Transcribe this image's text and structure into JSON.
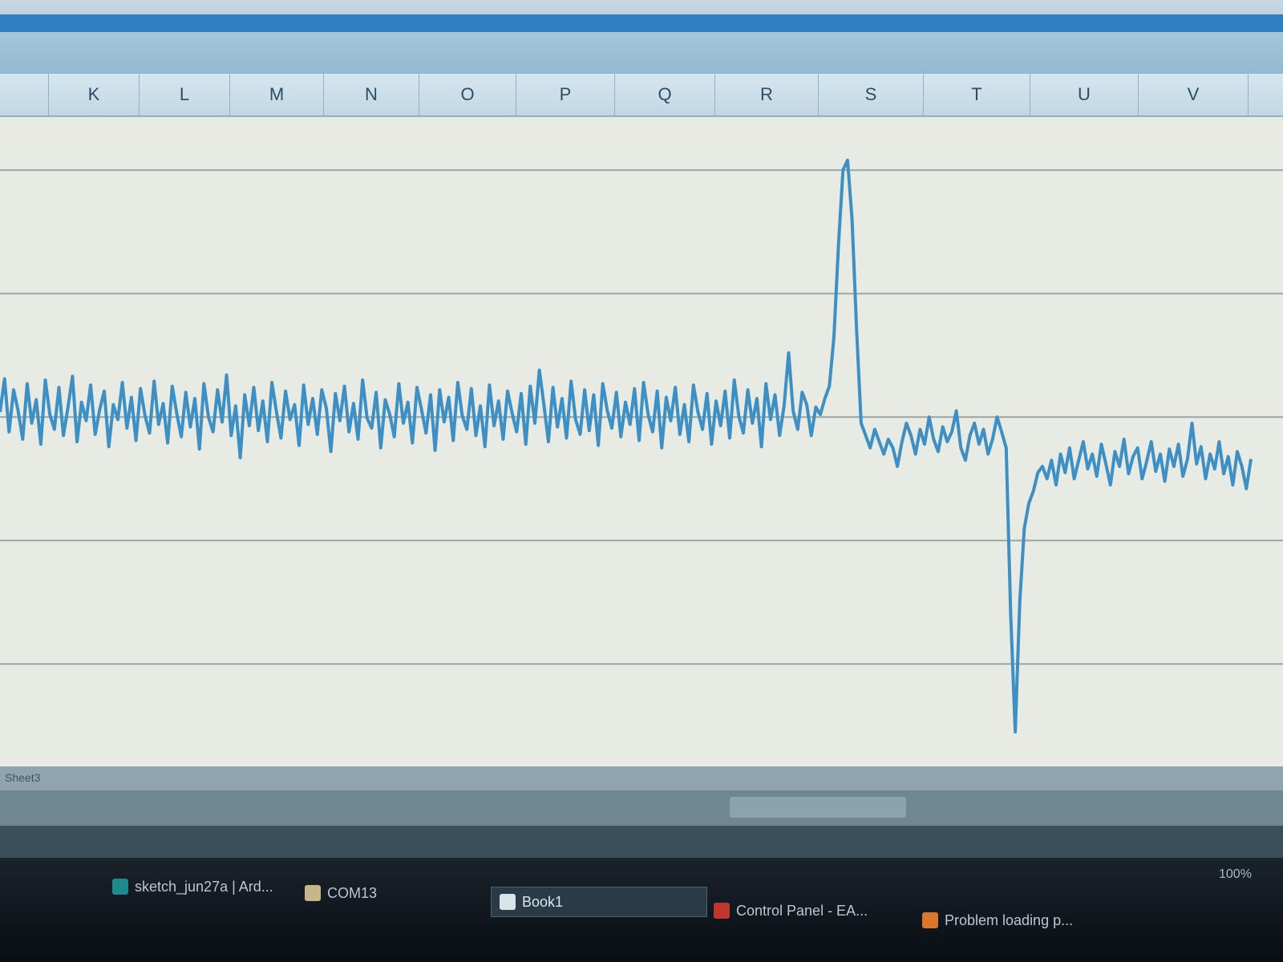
{
  "app": {
    "window": "Book1"
  },
  "column_headers": [
    "K",
    "L",
    "M",
    "N",
    "O",
    "P",
    "Q",
    "R",
    "S",
    "T",
    "U",
    "V"
  ],
  "sheet_tab": "Sheet3",
  "taskbar": {
    "items": [
      {
        "label": "sketch_jun27a | Ard...",
        "icon": "arduino-icon",
        "active": false
      },
      {
        "label": "COM13",
        "icon": "window-icon",
        "active": false
      },
      {
        "label": "Book1",
        "icon": "excel-icon",
        "active": true
      },
      {
        "label": "Control Panel - EA...",
        "icon": "control-panel-icon",
        "active": false
      },
      {
        "label": "Problem loading p...",
        "icon": "firefox-icon",
        "active": false
      }
    ]
  },
  "status": {
    "zoom": "100%"
  },
  "colors": {
    "series": "#3d8fc4",
    "plot_bg": "#e7ebe3",
    "gridline": "#9aa6a6"
  },
  "chart_data": {
    "type": "line",
    "series": [
      {
        "values": [
          0.04,
          0.31,
          -0.12,
          0.22,
          0.05,
          -0.18,
          0.27,
          -0.05,
          0.14,
          -0.22,
          0.3,
          0.02,
          -0.1,
          0.24,
          -0.15,
          0.08,
          0.33,
          -0.2,
          0.12,
          -0.03,
          0.26,
          -0.14,
          0.06,
          0.21,
          -0.24,
          0.1,
          -0.02,
          0.28,
          -0.09,
          0.16,
          -0.19,
          0.23,
          0.01,
          -0.13,
          0.29,
          -0.06,
          0.11,
          -0.21,
          0.25,
          0.03,
          -0.16,
          0.2,
          -0.08,
          0.15,
          -0.26,
          0.27,
          0.0,
          -0.12,
          0.22,
          -0.04,
          0.34,
          -0.15,
          0.09,
          -0.33,
          0.18,
          -0.07,
          0.24,
          -0.11,
          0.13,
          -0.2,
          0.28,
          0.04,
          -0.17,
          0.21,
          -0.02,
          0.1,
          -0.23,
          0.26,
          -0.06,
          0.15,
          -0.14,
          0.22,
          0.07,
          -0.28,
          0.19,
          -0.03,
          0.25,
          -0.12,
          0.11,
          -0.18,
          0.3,
          -0.01,
          -0.09,
          0.2,
          -0.25,
          0.14,
          0.02,
          -0.16,
          0.27,
          -0.05,
          0.12,
          -0.21,
          0.24,
          0.06,
          -0.13,
          0.18,
          -0.27,
          0.22,
          -0.04,
          0.16,
          -0.19,
          0.28,
          0.01,
          -0.1,
          0.23,
          -0.15,
          0.09,
          -0.24,
          0.26,
          -0.07,
          0.13,
          -0.18,
          0.21,
          0.03,
          -0.12,
          0.19,
          -0.22,
          0.25,
          -0.05,
          0.38,
          0.1,
          -0.2,
          0.24,
          -0.08,
          0.15,
          -0.17,
          0.29,
          -0.02,
          -0.14,
          0.22,
          -0.11,
          0.18,
          -0.23,
          0.27,
          0.05,
          -0.09,
          0.2,
          -0.16,
          0.12,
          -0.06,
          0.23,
          -0.19,
          0.28,
          0.02,
          -0.12,
          0.21,
          -0.25,
          0.16,
          -0.03,
          0.24,
          -0.14,
          0.1,
          -0.2,
          0.26,
          0.04,
          -0.1,
          0.19,
          -0.22,
          0.13,
          -0.07,
          0.21,
          -0.17,
          0.3,
          0.01,
          -0.13,
          0.22,
          -0.05,
          0.15,
          -0.24,
          0.27,
          -0.02,
          0.18,
          -0.15,
          0.09,
          0.52,
          0.05,
          -0.1,
          0.2,
          0.1,
          -0.15,
          0.08,
          0.02,
          0.15,
          0.25,
          0.65,
          1.4,
          2.0,
          2.08,
          1.6,
          0.7,
          -0.05,
          -0.15,
          -0.25,
          -0.1,
          -0.2,
          -0.3,
          -0.18,
          -0.25,
          -0.4,
          -0.2,
          -0.05,
          -0.15,
          -0.3,
          -0.1,
          -0.22,
          0.0,
          -0.18,
          -0.28,
          -0.08,
          -0.2,
          -0.12,
          0.05,
          -0.25,
          -0.35,
          -0.15,
          -0.05,
          -0.22,
          -0.1,
          -0.3,
          -0.18,
          0.0,
          -0.12,
          -0.25,
          -1.6,
          -2.55,
          -1.5,
          -0.9,
          -0.7,
          -0.6,
          -0.45,
          -0.4,
          -0.5,
          -0.35,
          -0.55,
          -0.3,
          -0.45,
          -0.25,
          -0.5,
          -0.35,
          -0.2,
          -0.42,
          -0.3,
          -0.48,
          -0.22,
          -0.38,
          -0.55,
          -0.28,
          -0.4,
          -0.18,
          -0.46,
          -0.32,
          -0.25,
          -0.5,
          -0.36,
          -0.2,
          -0.44,
          -0.3,
          -0.52,
          -0.26,
          -0.4,
          -0.22,
          -0.48,
          -0.34,
          -0.05,
          -0.38,
          -0.24,
          -0.5,
          -0.3,
          -0.42,
          -0.2,
          -0.46,
          -0.32,
          -0.55,
          -0.28,
          -0.4,
          -0.58,
          -0.34
        ]
      }
    ],
    "ylim": [
      -2.7,
      2.3
    ],
    "grid": true,
    "legend": false
  }
}
